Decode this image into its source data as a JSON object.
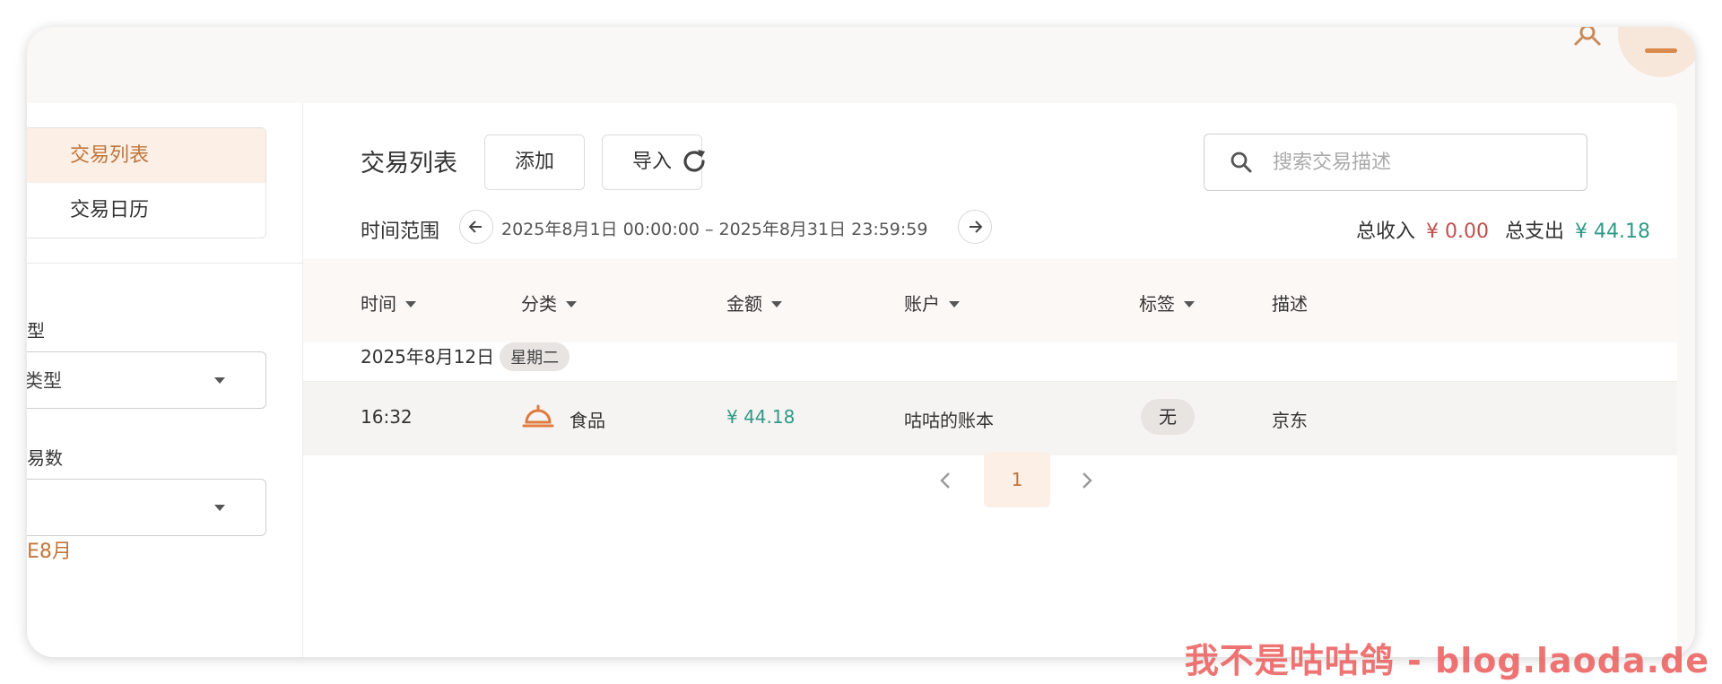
{
  "sidebar": {
    "nav": [
      "交易列表",
      "交易日历"
    ],
    "type_label": "型",
    "type_select_value": "类型",
    "count_label": "易数",
    "count_select_value": "",
    "month_label": "E8月"
  },
  "main": {
    "title": "交易列表",
    "add_label": "添加",
    "import_label": "导入",
    "search_placeholder": "搜索交易描述",
    "time_range_label": "时间范围",
    "time_range_value": "2025年8月1日 00:00:00 – 2025年8月31日 23:59:59",
    "income_label": "总收入",
    "income_value": "¥ 0.00",
    "expense_label": "总支出",
    "expense_value": "¥ 44.18"
  },
  "table": {
    "headers": [
      "时间",
      "分类",
      "金额",
      "账户",
      "标签",
      "描述"
    ],
    "groups": [
      {
        "date": "2025年8月12日",
        "weekday": "星期二",
        "rows": [
          {
            "time": "16:32",
            "category": "食品",
            "amount": "¥ 44.18",
            "account": "咕咕的账本",
            "tag": "无",
            "description": "京东"
          }
        ]
      }
    ]
  },
  "pagination": {
    "current": "1"
  },
  "watermark": "我不是咕咕鸽 - blog.laoda.de",
  "colors": {
    "accent": "#c1753a",
    "income": "#c0504d",
    "expense": "#2f9a86"
  }
}
